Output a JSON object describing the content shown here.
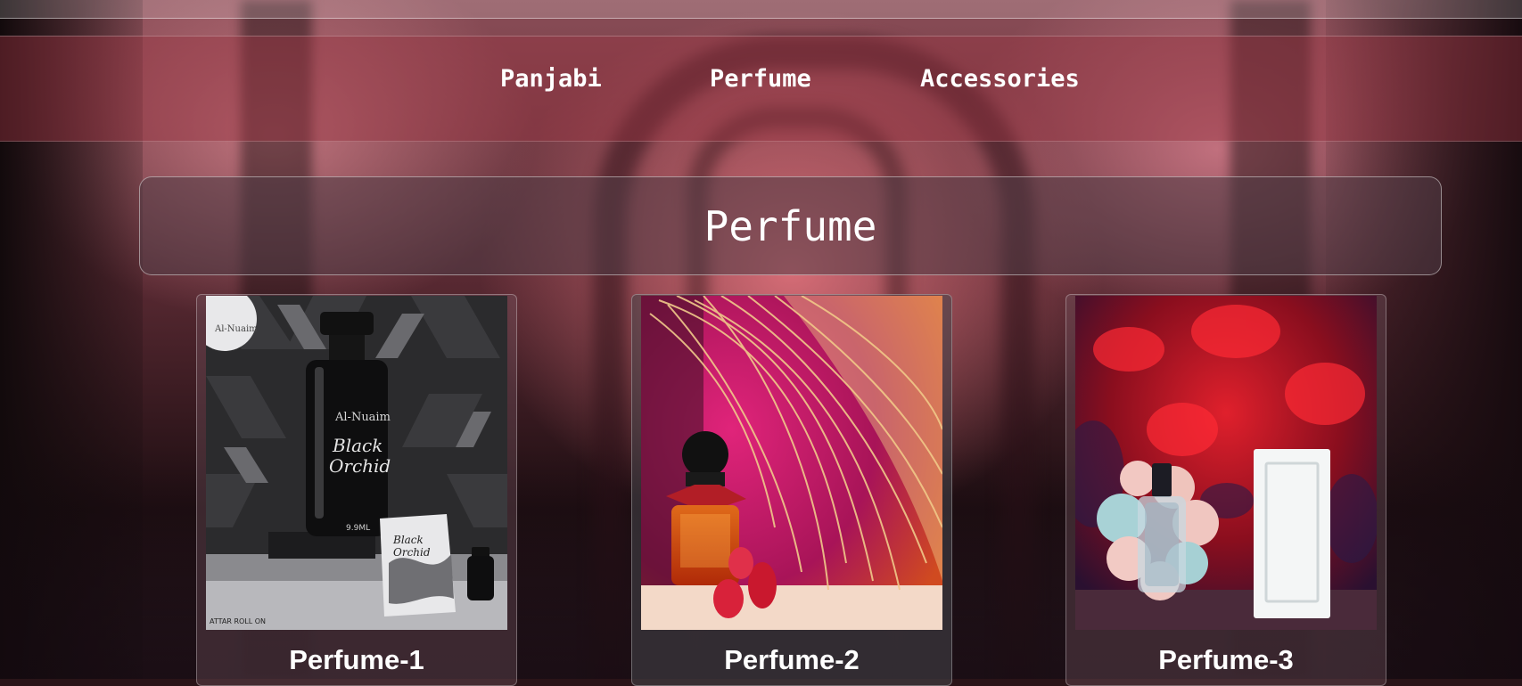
{
  "nav": {
    "items": [
      {
        "label": "Panjabi"
      },
      {
        "label": "Perfume"
      },
      {
        "label": "Accessories"
      }
    ]
  },
  "page_title": "Perfume",
  "products": [
    {
      "title": "Perfume-1",
      "image": {
        "brand_badge": "Al-Nuaim",
        "bottle_brand": "Al-Nuaim",
        "bottle_name_line1": "Black",
        "bottle_name_line2": "Orchid",
        "volume": "9.9ML",
        "box_name_line1": "Black",
        "box_name_line2": "Orchid",
        "footer_text": "ATTAR ROLL ON"
      }
    },
    {
      "title": "Perfume-2"
    },
    {
      "title": "Perfume-3"
    }
  ],
  "colors": {
    "nav_band": "#963241",
    "title_panel": "#503c46",
    "text": "#ffffff"
  }
}
